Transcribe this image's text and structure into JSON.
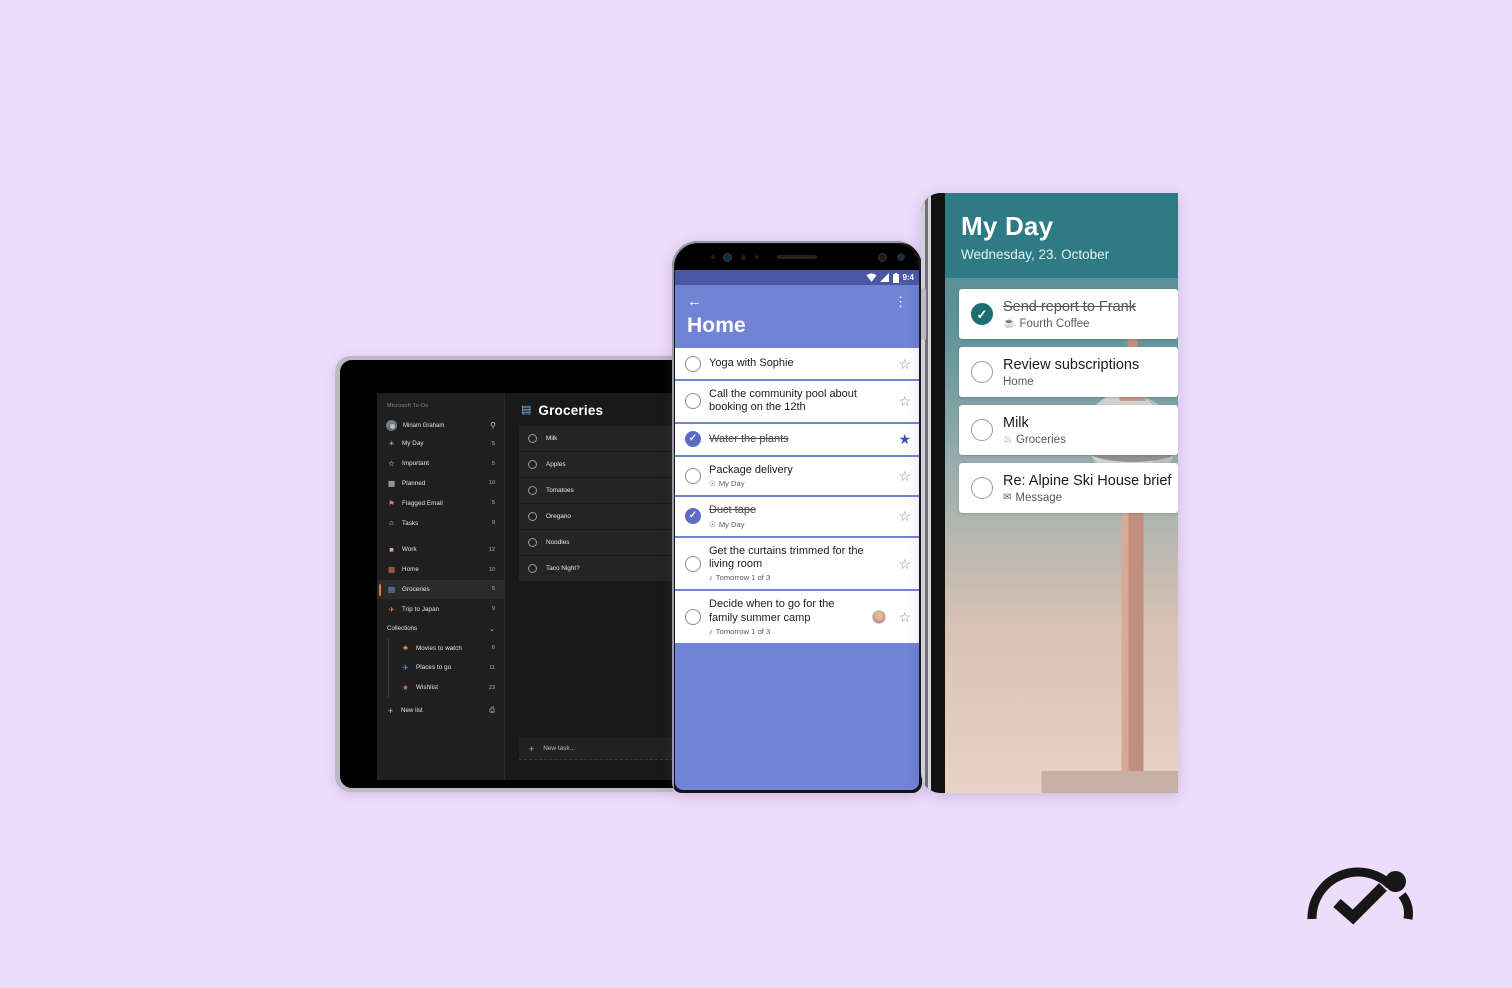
{
  "background_color": "#eedcfc",
  "tablet": {
    "device": "tablet",
    "app_brand": "Microsoft To-Do",
    "theme_color": "#191919",
    "account": {
      "name": "Miriam Graham",
      "avatar": "user-avatar",
      "search_icon": "search-icon"
    },
    "nav": [
      {
        "icon": "sun-icon",
        "glyph": "☀",
        "color": "#6fc4d9",
        "label": "My Day",
        "count": "5"
      },
      {
        "icon": "star-icon",
        "glyph": "☆",
        "color": "#e3e3e3",
        "label": "Important",
        "count": "5"
      },
      {
        "icon": "calendar-icon",
        "glyph": "☷",
        "color": "#d8d8d8",
        "label": "Planned",
        "count": "10"
      },
      {
        "icon": "flag-icon",
        "glyph": "⚑",
        "color": "#e07a7a",
        "label": "Flagged Email",
        "count": "5"
      },
      {
        "icon": "home-icon",
        "glyph": "⌂",
        "color": "#d8d8d8",
        "label": "Tasks",
        "count": "9"
      }
    ],
    "lists": [
      {
        "icon": "briefcase-icon",
        "glyph": "■",
        "color": "#e8a27c",
        "label": "Work",
        "count": "12",
        "selected": false
      },
      {
        "icon": "house-icon",
        "glyph": "☖",
        "color": "#e07a5f",
        "label": "Home",
        "count": "10",
        "selected": false
      },
      {
        "icon": "groceries-icon",
        "glyph": "▤",
        "color": "#7fb3e8",
        "label": "Groceries",
        "count": "5",
        "selected": true
      },
      {
        "icon": "airplane-icon",
        "glyph": "✈",
        "color": "#e08a5f",
        "label": "Trip to Japan",
        "count": "9",
        "selected": false
      }
    ],
    "collections": {
      "label": "Collections",
      "chevron": "chevron-down-icon",
      "items": [
        {
          "icon": "popcorn-icon",
          "glyph": "♣",
          "color": "#e08a5f",
          "label": "Movies to watch",
          "count": "6"
        },
        {
          "icon": "plane-icon",
          "glyph": "✈",
          "color": "#5b9ee0",
          "label": "Places to go",
          "count": "11"
        },
        {
          "icon": "star-icon",
          "glyph": "★",
          "color": "#e0734a",
          "label": "Wishlist",
          "count": "23"
        }
      ]
    },
    "new_list": {
      "label": "New list",
      "plus": "+",
      "group_icon": "new-group-icon"
    },
    "main": {
      "list_icon": "groceries-icon",
      "list_title": "Groceries",
      "tasks": [
        {
          "text": "Milk",
          "done": false
        },
        {
          "text": "Apples",
          "done": false
        },
        {
          "text": "Tomatoes",
          "done": false
        },
        {
          "text": "Oregano",
          "done": false
        },
        {
          "text": "Noodles",
          "done": false
        },
        {
          "text": "Taco Night?",
          "done": false
        }
      ],
      "new_task_placeholder": "New task..."
    }
  },
  "phone_android": {
    "device": "android-phone",
    "accent_color": "#7083d4",
    "status_bar": {
      "time": "9:4",
      "wifi": "wifi-icon",
      "signal": "signal-icon",
      "battery": "battery-icon"
    },
    "appbar": {
      "back": "back-arrow-icon",
      "overflow": "more-vertical-icon",
      "title": "Home"
    },
    "tasks": [
      {
        "text": "Yoga with Sophie",
        "done": false,
        "starred": false,
        "sub": "",
        "sub_icon": "",
        "avatar": false
      },
      {
        "text": "Call the community pool about booking on the 12th",
        "done": false,
        "starred": false,
        "sub": "",
        "sub_icon": "",
        "avatar": false
      },
      {
        "text": "Water the plants",
        "done": true,
        "starred": true,
        "sub": "",
        "sub_icon": "",
        "avatar": false
      },
      {
        "text": "Package delivery",
        "done": false,
        "starred": false,
        "sub": "My Day",
        "sub_icon": "sun-icon",
        "avatar": false
      },
      {
        "text": "Duct tape",
        "done": true,
        "starred": false,
        "sub": "My Day",
        "sub_icon": "sun-icon",
        "avatar": false
      },
      {
        "text": "Get the curtains trimmed for the living room",
        "done": false,
        "starred": false,
        "sub": "Tomorrow  1 of 3",
        "sub_icon": "bell-icon",
        "avatar": false
      },
      {
        "text": "Decide when to go for the family summer camp",
        "done": false,
        "starred": false,
        "sub": "Tomorrow  1 of 3",
        "sub_icon": "bell-icon",
        "avatar": true
      }
    ]
  },
  "phone_myday": {
    "device": "phone",
    "accent_color": "#2f7b85",
    "header": {
      "title": "My Day",
      "date": "Wednesday, 23. October"
    },
    "background_photo": "berlin-tv-tower-photo",
    "tasks": [
      {
        "text": "Send report to Frank",
        "done": true,
        "sub": "Fourth Coffee",
        "sub_icon": "coffee-icon",
        "glyph": "☕"
      },
      {
        "text": "Review subscriptions",
        "done": false,
        "sub": "Home",
        "sub_icon": "",
        "glyph": ""
      },
      {
        "text": "Milk",
        "done": false,
        "sub": "Groceries",
        "sub_icon": "groceries-icon",
        "glyph": "🌶"
      },
      {
        "text": "Re: Alpine Ski House brief",
        "done": false,
        "sub": "Message",
        "sub_icon": "envelope-icon",
        "glyph": "✉"
      }
    ]
  },
  "logo": {
    "name": "microsoft-to-do-logo",
    "alt": "Microsoft To Do logo"
  }
}
